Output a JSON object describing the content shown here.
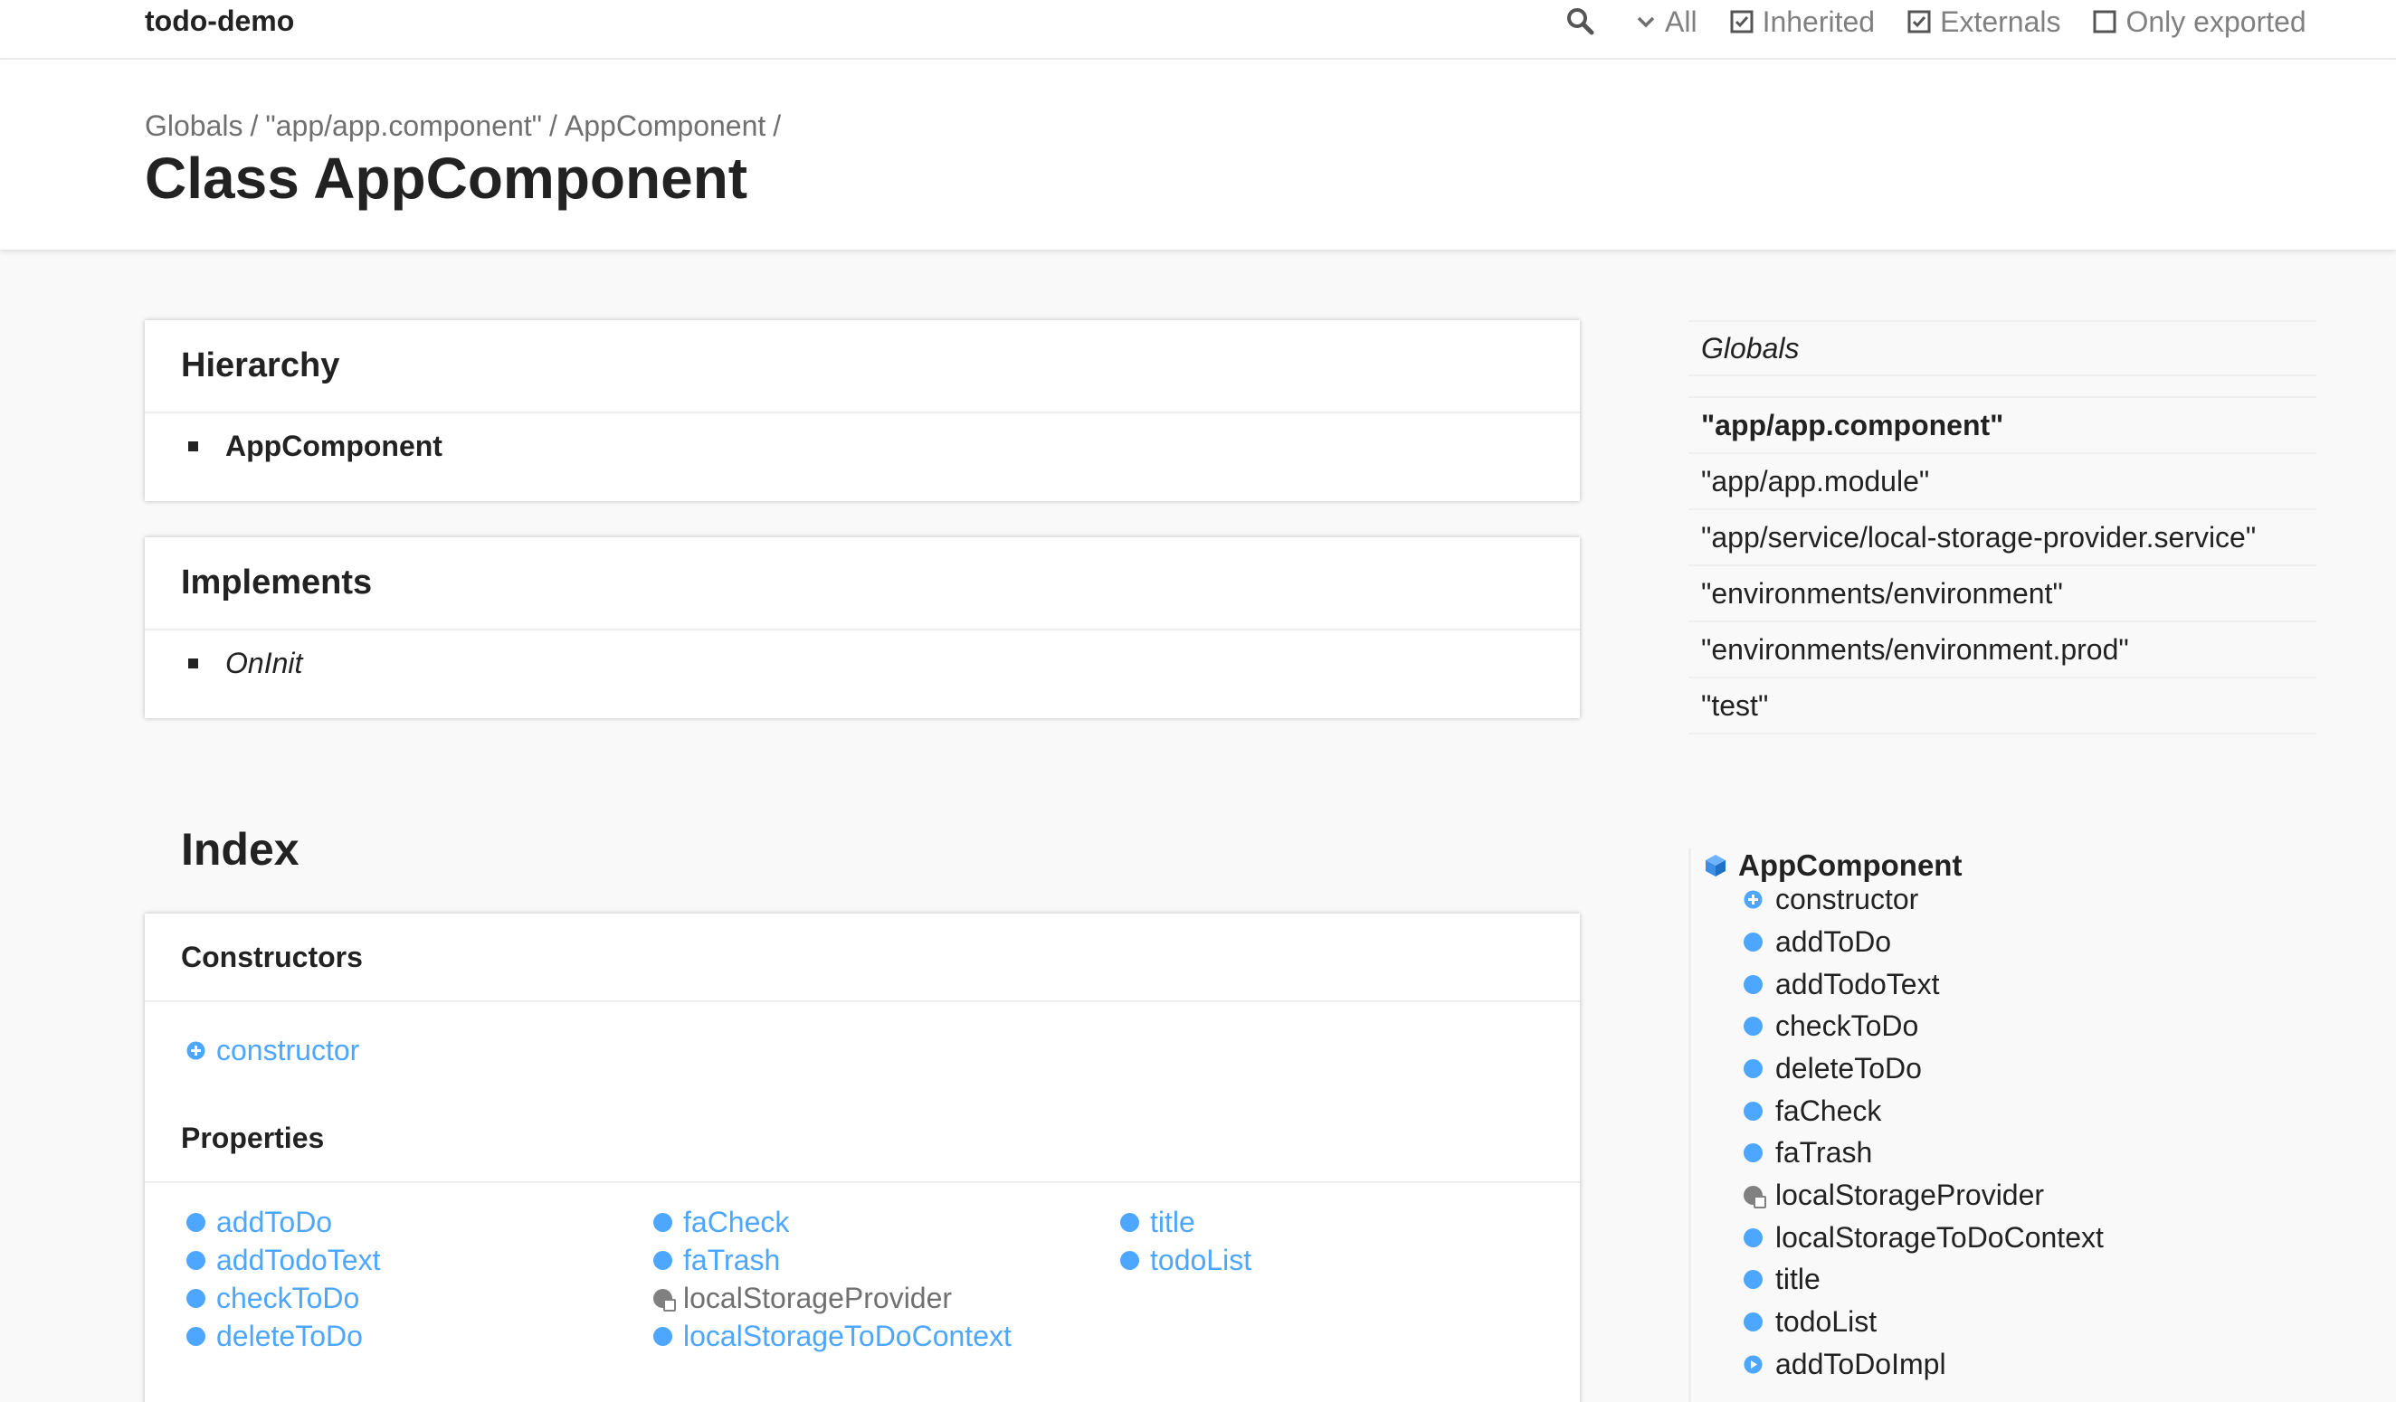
{
  "toolbar": {
    "app_title": "todo-demo",
    "filters": [
      {
        "label": "All",
        "icon": "chevron-down-icon"
      },
      {
        "label": "Inherited",
        "checked": true
      },
      {
        "label": "Externals",
        "checked": true
      },
      {
        "label": "Only exported",
        "checked": false
      }
    ]
  },
  "breadcrumb": [
    "Globals",
    "\"app/app.component\"",
    "AppComponent"
  ],
  "page_title": "Class AppComponent",
  "hierarchy": {
    "heading": "Hierarchy",
    "items": [
      "AppComponent"
    ]
  },
  "implements": {
    "heading": "Implements",
    "items": [
      "OnInit"
    ]
  },
  "index": {
    "title": "Index",
    "constructors": {
      "heading": "Constructors",
      "items": [
        "constructor"
      ]
    },
    "properties": {
      "heading": "Properties",
      "columns": [
        [
          "addToDo",
          "addTodoText",
          "checkToDo",
          "deleteToDo"
        ],
        [
          "faCheck",
          "faTrash",
          "localStorageProvider",
          "localStorageToDoContext"
        ],
        [
          "title",
          "todoList"
        ]
      ]
    }
  },
  "globals_nav": {
    "heading": "Globals",
    "modules": [
      "\"app/app.component\"",
      "\"app/app.module\"",
      "\"app/service/local-storage-provider.service\"",
      "\"environments/environment\"",
      "\"environments/environment.prod\"",
      "\"test\""
    ]
  },
  "member_nav": {
    "class_name": "AppComponent",
    "items": [
      "constructor",
      "addToDo",
      "addTodoText",
      "checkToDo",
      "deleteToDo",
      "faCheck",
      "faTrash",
      "localStorageProvider",
      "localStorageToDoContext",
      "title",
      "todoList",
      "addToDoImpl"
    ]
  },
  "colors": {
    "link": "#4da6ff",
    "private": "#808080",
    "text": "#222222",
    "muted": "#808080"
  }
}
